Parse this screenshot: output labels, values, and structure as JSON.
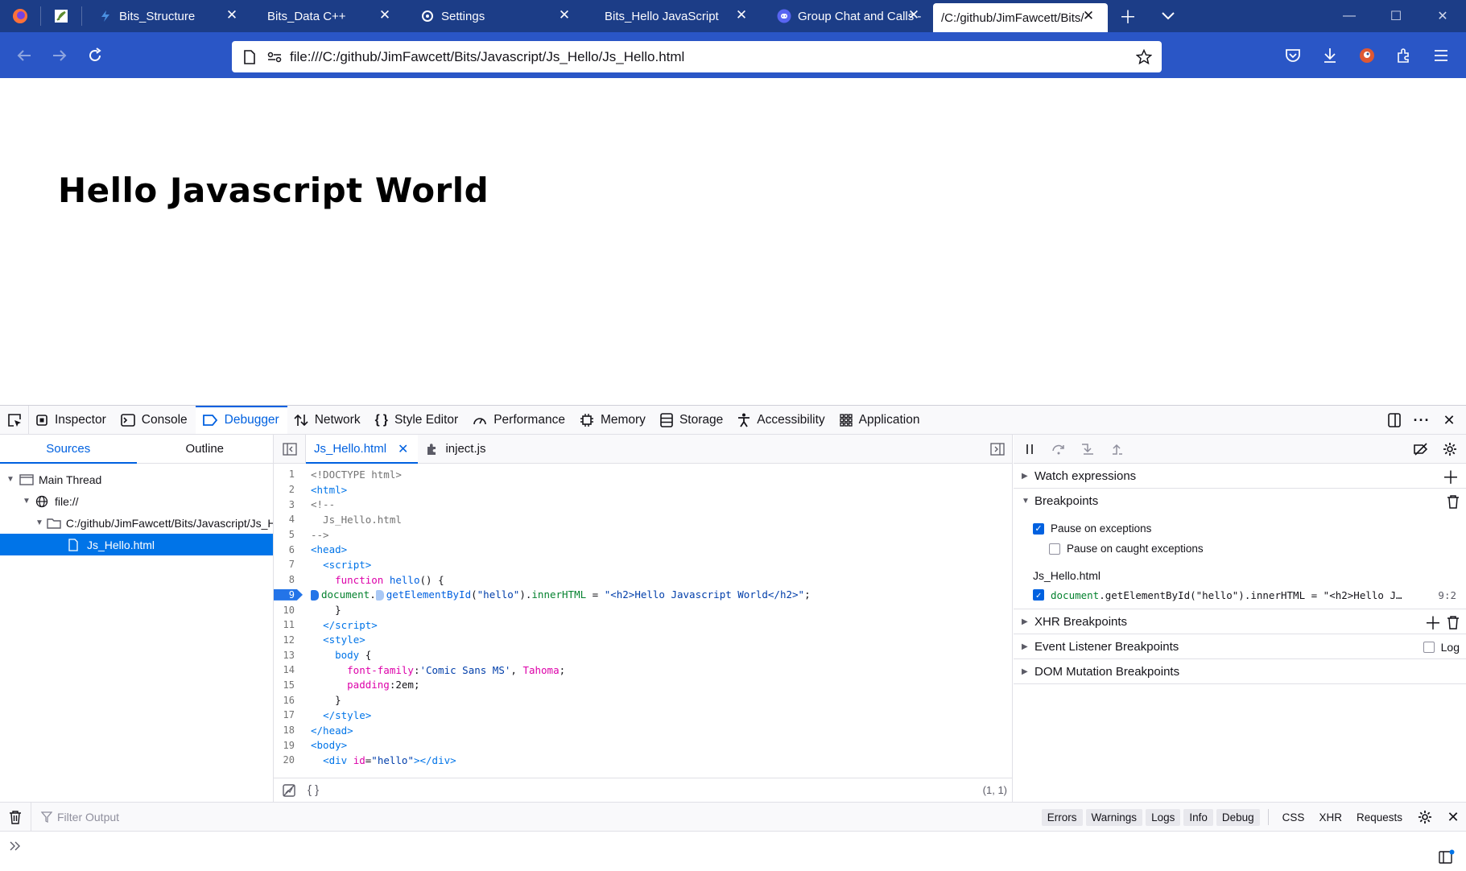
{
  "browser": {
    "tabs": [
      {
        "label": "",
        "icon": "firefox-icon",
        "pinned": true
      },
      {
        "label": "",
        "icon": "leaf-icon",
        "pinned": true
      },
      {
        "label": "Bits_Structure",
        "icon": "code-icon"
      },
      {
        "label": "Bits_Data C++",
        "icon": ""
      },
      {
        "label": "Settings",
        "icon": "gear-icon"
      },
      {
        "label": "Bits_Hello JavaScript",
        "icon": ""
      },
      {
        "label": "Group Chat and Calls - ",
        "icon": "discord-icon"
      },
      {
        "label": "/C:/github/JimFawcett/Bits/",
        "icon": "",
        "active": true
      }
    ],
    "url": "file:///C:/github/JimFawcett/Bits/Javascript/Js_Hello/Js_Hello.html"
  },
  "page": {
    "heading": "Hello Javascript World"
  },
  "devtools": {
    "tabs": [
      "Inspector",
      "Console",
      "Debugger",
      "Network",
      "Style Editor",
      "Performance",
      "Memory",
      "Storage",
      "Accessibility",
      "Application"
    ],
    "active_tab": "Debugger",
    "sources": {
      "tabs": [
        "Sources",
        "Outline"
      ],
      "tree": [
        "Main Thread",
        "file://",
        "C:/github/JimFawcett/Bits/Javascript/Js_H",
        "Js_Hello.html"
      ]
    },
    "editor": {
      "tabs": [
        "Js_Hello.html",
        "inject.js"
      ],
      "cursor": "(1, 1)",
      "pretty_print": "{ }",
      "breakpoint_line": 9
    },
    "right_pane": {
      "watch": "Watch expressions",
      "breakpoints": "Breakpoints",
      "pause_on_exceptions": "Pause on exceptions",
      "pause_on_caught": "Pause on caught exceptions",
      "bp_file": "Js_Hello.html",
      "bp_code": "document.getElementById(\"hello\").innerHTML = \"<h2>Hello J…",
      "bp_code_obj": "document",
      "bp_code_rest": ".getElementById(\"hello\").innerHTML = \"<h2>Hello J…",
      "bp_loc": "9:2",
      "xhr": "XHR Breakpoints",
      "event": "Event Listener Breakpoints",
      "log": "Log",
      "dom": "DOM Mutation Breakpoints"
    },
    "console": {
      "filter_placeholder": "Filter Output",
      "levels": [
        "Errors",
        "Warnings",
        "Logs",
        "Info",
        "Debug"
      ],
      "extra": [
        "CSS",
        "XHR",
        "Requests"
      ]
    }
  },
  "colors": {
    "tabstrip": "#1c3d87",
    "navbar": "#2a56c6",
    "accent": "#0061e0",
    "selected": "#0074e8"
  }
}
